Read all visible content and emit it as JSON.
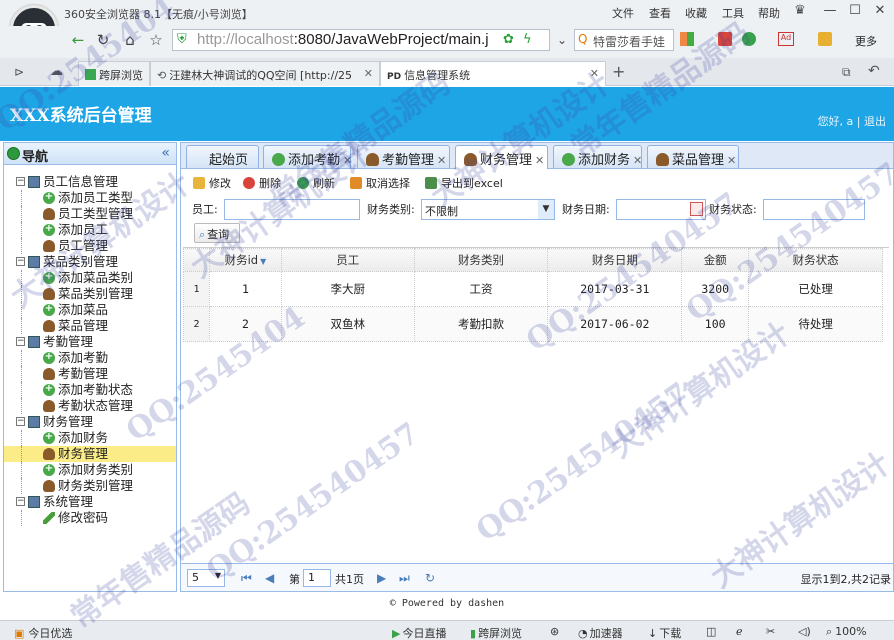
{
  "browser": {
    "window_title": "360安全浏览器 8.1【无痕/小号浏览】",
    "menu": [
      "文件",
      "查看",
      "收藏",
      "工具",
      "帮助"
    ],
    "url_host": "http://localhost",
    "url_rest": ":8080/JavaWebProject/main.j",
    "search_text": "特雷莎看手娃",
    "more_label": "更多",
    "tabs": [
      {
        "label": "跨屏浏览"
      },
      {
        "label": "汪建林大神调试的QQ空间 [http://25"
      },
      {
        "label": "信息管理系统"
      }
    ],
    "new_tab": "+"
  },
  "app": {
    "title": "XXX系统后台管理",
    "welcome": "您好, a  |  退出"
  },
  "sidebar": {
    "title": "导航",
    "collapse": "«",
    "groups": [
      {
        "label": "员工信息管理",
        "items": [
          "添加员工类型",
          "员工类型管理",
          "添加员工",
          "员工管理"
        ]
      },
      {
        "label": "菜品类别管理",
        "items": [
          "添加菜品类别",
          "菜品类别管理",
          "添加菜品",
          "菜品管理"
        ]
      },
      {
        "label": "考勤管理",
        "items": [
          "添加考勤",
          "考勤管理",
          "添加考勤状态",
          "考勤状态管理"
        ]
      },
      {
        "label": "财务管理",
        "items": [
          "添加财务",
          "财务管理",
          "添加财务类别",
          "财务类别管理"
        ]
      },
      {
        "label": "系统管理",
        "items": [
          "修改密码"
        ]
      }
    ]
  },
  "main": {
    "tabs": [
      "起始页",
      "添加考勤",
      "考勤管理",
      "财务管理",
      "添加财务",
      "菜品管理"
    ],
    "toolbar": [
      "修改",
      "删除",
      "刷新",
      "取消选择",
      "导出到excel"
    ],
    "filters": {
      "employee_label": "员工:",
      "type_label": "财务类别:",
      "type_value": "不限制",
      "date_label": "财务日期:",
      "status_label": "财务状态:",
      "query_button": "查询"
    },
    "grid": {
      "columns": [
        "财务id",
        "员工",
        "财务类别",
        "财务日期",
        "金额",
        "财务状态"
      ],
      "sort_indicator": "▼",
      "rows": [
        {
          "rownum": "1",
          "id": "1",
          "employee": "李大厨",
          "type": "工资",
          "date": "2017-03-31",
          "amount": "3200",
          "status": "已处理"
        },
        {
          "rownum": "2",
          "id": "2",
          "employee": "双鱼林",
          "type": "考勤扣款",
          "date": "2017-06-02",
          "amount": "100",
          "status": "待处理"
        }
      ]
    },
    "pager": {
      "page_size": "5",
      "page_prefix": "第",
      "page_number": "1",
      "page_total": "共1页",
      "summary": "显示1到2,共2记录"
    }
  },
  "footer": "© Powered by dashen",
  "statusbar": {
    "left": "今日优选",
    "live": "今日直播",
    "cross": "跨屏浏览",
    "accel": "加速器",
    "download": "下载",
    "zoom": "100%"
  },
  "watermarks": [
    "QQ:2545404",
    "大神计算机设计",
    "常年售精品源码",
    "QQ:2545404",
    "大神计算机设计",
    "QQ:254540457",
    "常年售精品源码",
    "大神计算机设计",
    "QQ:254540457",
    "QQ:254540457",
    "常年售精品源码",
    "大神计算机设计",
    "QQ:254540457",
    "大神计算机设计"
  ]
}
